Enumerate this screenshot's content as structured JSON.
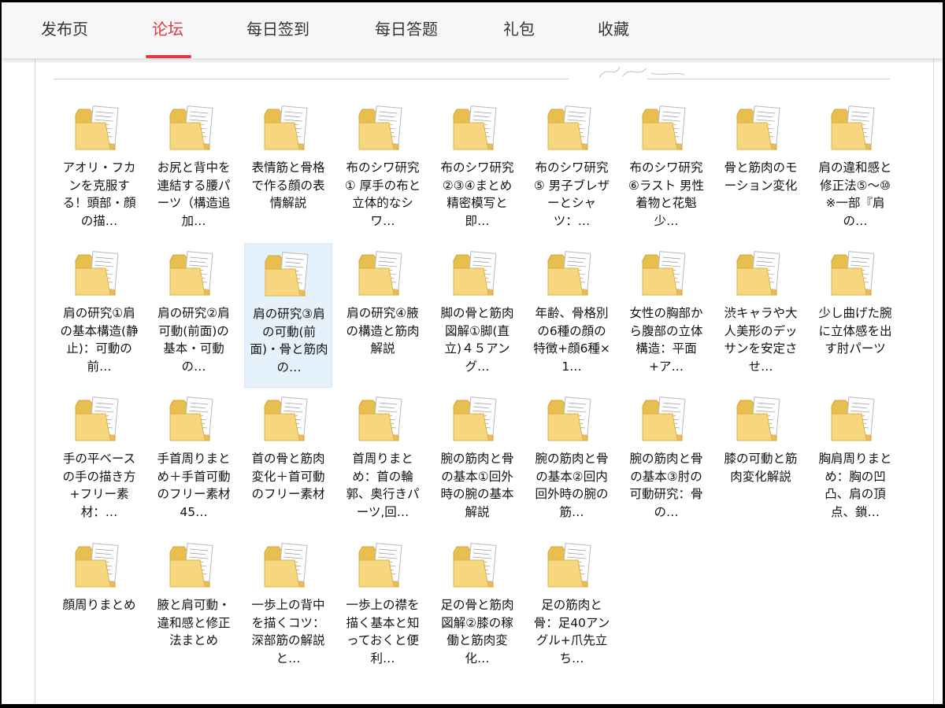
{
  "tabs": [
    {
      "label": "发布页",
      "active": false
    },
    {
      "label": "论坛",
      "active": true
    },
    {
      "label": "每日签到",
      "active": false
    },
    {
      "label": "每日答题",
      "active": false
    },
    {
      "label": "礼包",
      "active": false
    },
    {
      "label": "收藏",
      "active": false
    }
  ],
  "colors": {
    "accent": "#e0383e",
    "folder": "#f6d77f",
    "selection": "#e5f1fb"
  },
  "folder_icon": "folder-icon",
  "folders": [
    {
      "name": "アオリ・フカンを克服する！頭部・顔の描…",
      "selected": false
    },
    {
      "name": "お尻と背中を連結する腰パーツ（構造追加…",
      "selected": false
    },
    {
      "name": "表情筋と骨格で作る顔の表情解説",
      "selected": false
    },
    {
      "name": "布のシワ研究① 厚手の布と立体的なシワ…",
      "selected": false
    },
    {
      "name": "布のシワ研究②③④まとめ 精密模写と即…",
      "selected": false
    },
    {
      "name": "布のシワ研究⑤ 男子ブレザーとシャツ：…",
      "selected": false
    },
    {
      "name": "布のシワ研究⑥ラスト 男性着物と花魁少…",
      "selected": false
    },
    {
      "name": "骨と筋肉のモーション変化",
      "selected": false
    },
    {
      "name": "肩の違和感と修正法⑤～⑩※一部『肩の…",
      "selected": false
    },
    {
      "name": "肩の研究①肩の基本構造(静止)：可動の前…",
      "selected": false
    },
    {
      "name": "肩の研究②肩可動(前面)の基本・可動の…",
      "selected": false
    },
    {
      "name": "肩の研究③肩の可動(前面)・骨と筋肉の…",
      "selected": true
    },
    {
      "name": "肩の研究④腋の構造と筋肉解説",
      "selected": false
    },
    {
      "name": "脚の骨と筋肉図解①脚(直立)４５アング…",
      "selected": false
    },
    {
      "name": "年齢、骨格別の6種の顔の特徴+顔6種×1…",
      "selected": false
    },
    {
      "name": "女性の胸部から腹部の立体構造：平面+ア…",
      "selected": false
    },
    {
      "name": "渋キャラや大人美形のデッサンを安定させ…",
      "selected": false
    },
    {
      "name": "少し曲げた腕に立体感を出す肘パーツ",
      "selected": false
    },
    {
      "name": "手の平ベースの手の描き方+フリー素材：…",
      "selected": false
    },
    {
      "name": "手首周りまとめ＋手首可動のフリー素材45…",
      "selected": false
    },
    {
      "name": "首の骨と筋肉変化＋首可動のフリー素材",
      "selected": false
    },
    {
      "name": "首周りまとめ：首の輪郭、奥行きパーツ,回…",
      "selected": false
    },
    {
      "name": "腕の筋肉と骨の基本①回外時の腕の基本解説",
      "selected": false
    },
    {
      "name": "腕の筋肉と骨の基本②回内回外時の腕の筋…",
      "selected": false
    },
    {
      "name": "腕の筋肉と骨の基本③肘の可動研究：骨の…",
      "selected": false
    },
    {
      "name": "膝の可動と筋肉変化解説",
      "selected": false
    },
    {
      "name": "胸肩周りまとめ：胸の凹凸、肩の頂点、鎖…",
      "selected": false
    },
    {
      "name": "顔周りまとめ",
      "selected": false
    },
    {
      "name": "腋と肩可動・違和感と修正法まとめ",
      "selected": false
    },
    {
      "name": "一歩上の背中を描くコツ：深部筋の解説と…",
      "selected": false
    },
    {
      "name": "一歩上の襟を描く基本と知っておくと便利…",
      "selected": false
    },
    {
      "name": "足の骨と筋肉図解②膝の稼働と筋肉変化…",
      "selected": false
    },
    {
      "name": "足の筋肉と骨：足40アングル+爪先立ち…",
      "selected": false
    }
  ]
}
